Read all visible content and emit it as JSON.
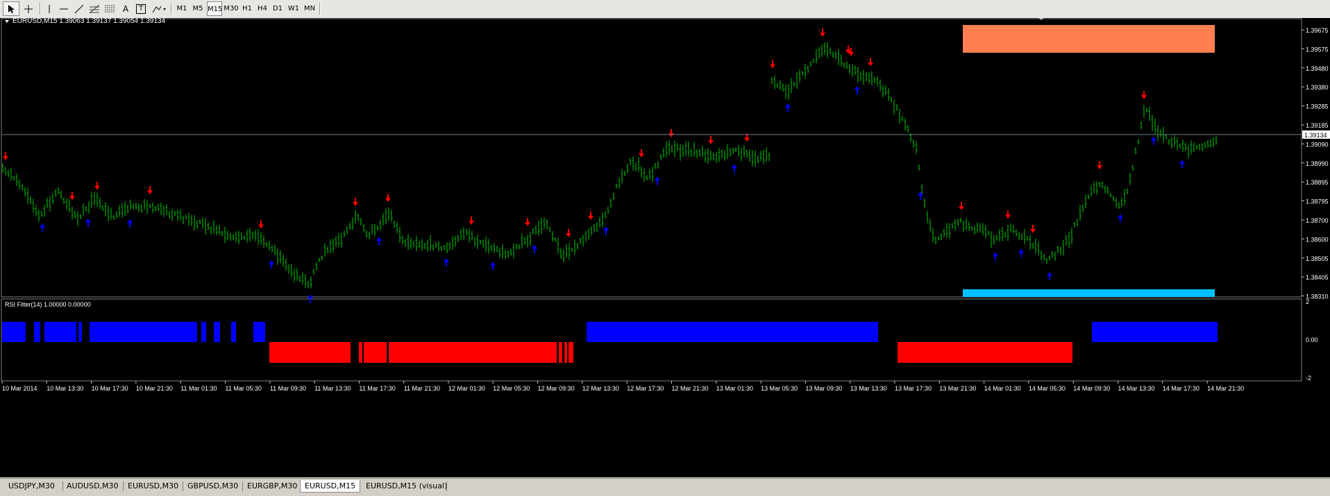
{
  "toolbar": {
    "tools": [
      {
        "name": "cursor-icon",
        "active": true
      },
      {
        "name": "crosshair-icon",
        "active": false
      },
      {
        "name": "vertical-line-icon",
        "active": false
      },
      {
        "name": "horizontal-line-icon",
        "active": false
      },
      {
        "name": "trendline-icon",
        "active": false
      },
      {
        "name": "fibonacci-icon",
        "active": false
      },
      {
        "name": "channel-icon",
        "active": false
      },
      {
        "name": "text-icon",
        "label": "A",
        "active": false
      },
      {
        "name": "text-label-icon",
        "label": "T",
        "active": false
      },
      {
        "name": "arrows-icon",
        "active": false
      }
    ],
    "timeframes": [
      "M1",
      "M5",
      "M15",
      "M30",
      "H1",
      "H4",
      "D1",
      "W1",
      "MN"
    ],
    "active_timeframe": "M15"
  },
  "chart": {
    "info": "EURUSD,M15  1.39063 1.39137 1.39054 1.39134",
    "current_price_label": "1.39134",
    "price_axis_labels": [
      "1.39675",
      "1.39575",
      "1.39480",
      "1.39380",
      "1.39285",
      "1.39185",
      "1.39090",
      "1.38990",
      "1.38895",
      "1.38795",
      "1.38700",
      "1.38600",
      "1.38505",
      "1.38405",
      "1.38310"
    ],
    "time_axis_labels": [
      "10 Mar 2014",
      "10 Mar 13:30",
      "10 Mar 17:30",
      "10 Mar 21:30",
      "11 Mar 01:30",
      "11 Mar 05:30",
      "11 Mar 09:30",
      "11 Mar 13:30",
      "11 Mar 17:30",
      "11 Mar 21:30",
      "12 Mar 01:30",
      "12 Mar 05:30",
      "12 Mar 09:30",
      "12 Mar 13:30",
      "12 Mar 17:30",
      "12 Mar 21:30",
      "13 Mar 01:30",
      "13 Mar 05:30",
      "13 Mar 09:30",
      "13 Mar 13:30",
      "13 Mar 17:30",
      "13 Mar 21:30",
      "14 Mar 01:30",
      "14 Mar 05:30",
      "14 Mar 09:30",
      "14 Mar 13:30",
      "14 Mar 17:30",
      "14 Mar 21:30"
    ],
    "bar_color": "#00c000",
    "up_arrow_color": "#0000ff",
    "down_arrow_color": "#ff0000",
    "resistance_zone_color": "#ff7f50",
    "support_zone_color": "#00bfff"
  },
  "indicator": {
    "title": "RSI Filter(14) 1.00000 0.00000",
    "axis_labels": [
      "2",
      "0.00",
      "-2"
    ],
    "bull_color": "#0000ff",
    "bear_color": "#ff0000"
  },
  "tabs": [
    {
      "label": "USDJPY,M30",
      "active": false
    },
    {
      "label": "AUDUSD,M30",
      "active": false
    },
    {
      "label": "EURUSD,M30",
      "active": false
    },
    {
      "label": "GBPUSD,M30",
      "active": false
    },
    {
      "label": "EURGBP,M30",
      "active": false
    },
    {
      "label": "EURUSD,M15",
      "active": true
    },
    {
      "label": "EURUSD,M15 (visual)",
      "active": false
    }
  ]
}
